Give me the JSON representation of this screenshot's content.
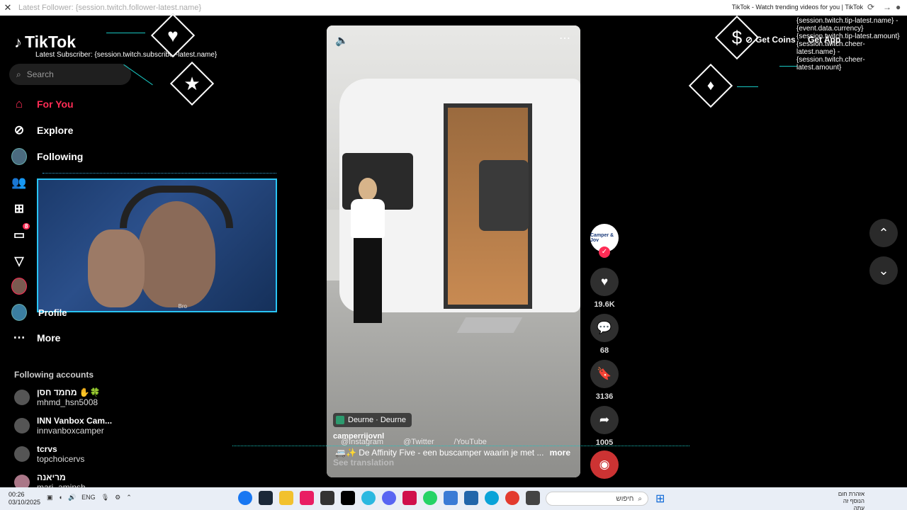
{
  "browser": {
    "tab_overlay": "Latest Follower: {session.twitch.follower-latest.name}",
    "page_title": "TikTok - Watch trending videos for you | TikTok"
  },
  "sidebar": {
    "logo": "TikTok",
    "subscriber_overlay": "Latest Subscriber: {session.twitch.subscriber-latest.name}",
    "search_placeholder": "Search",
    "nav": {
      "for_you": "For You",
      "explore": "Explore",
      "following": "Following",
      "profile": "Profile",
      "more": "More"
    },
    "messages_badge": "8",
    "accounts_title": "Following accounts",
    "accounts": [
      {
        "name": "מחמד חסן ✋🍀",
        "handle": "mhmd_hsn5008"
      },
      {
        "name": "INN Vanbox Cam...",
        "handle": "innvanboxcamper"
      },
      {
        "name": "tcrvs",
        "handle": "topchoicervs"
      },
      {
        "name": "מריאנה",
        "handle": "mari_aminsh"
      }
    ]
  },
  "webcam": {
    "caption": "Bro"
  },
  "video": {
    "location": "Deurne · Deurne",
    "username": "camperrijovnl",
    "socials": [
      "@Instagram",
      "@Twitter",
      "/YouTube"
    ],
    "caption": "🚐✨ De Affinity Five - een buscamper waarin je met ...",
    "more": "more",
    "see_translation": "See translation"
  },
  "actions": {
    "creator_label": "Camper & Jov",
    "likes": "19.6K",
    "comments": "68",
    "saves": "3136",
    "shares": "1005"
  },
  "topright": {
    "get_coins": "Get Coins",
    "get_app": "Get App",
    "overlay_text": "{session.twitch.tip-latest.name} - {event.data.currency} {session.twitch.tip-latest.amount} {session.twitch.cheer-latest.name} - {session.twitch.cheer-latest.amount}"
  },
  "taskbar": {
    "time": "00:26",
    "date": "03/10/2025",
    "lang": "ENG",
    "search": "חיפוש",
    "weather": "אזהרת חום",
    "weather_sub": "הנוסף זה עתה"
  },
  "colors": {
    "accent": "#fe2c55",
    "cyan": "#29c5f6",
    "teal": "#19c7c2"
  }
}
